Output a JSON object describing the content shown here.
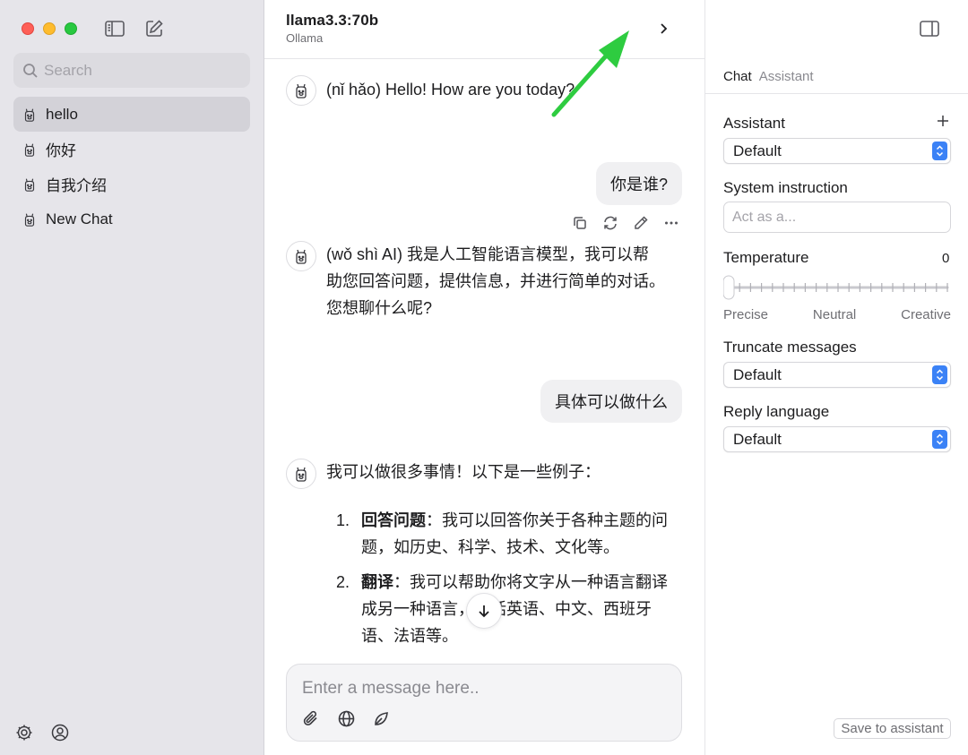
{
  "sidebar": {
    "search_placeholder": "Search",
    "chats": [
      {
        "label": "hello",
        "active": true
      },
      {
        "label": "你好",
        "active": false
      },
      {
        "label": "自我介绍",
        "active": false
      },
      {
        "label": "New Chat",
        "active": false
      }
    ]
  },
  "header": {
    "model_name": "llama3.3:70b",
    "provider": "Ollama"
  },
  "messages": {
    "m1_ai": "(nǐ hǎo) Hello! How are you today?",
    "m2_user": "你是谁?",
    "m3_ai_lines": [
      "(wǒ shì AI) 我是人工智能语言模型，我可以帮",
      "助您回答问题，提供信息，并进行简单的对话。",
      "您想聊什么呢?"
    ],
    "m4_user": "具体可以做什么",
    "m5_ai_intro": "我可以做很多事情！以下是一些例子：",
    "list": [
      {
        "num": "1.",
        "title": "回答问题",
        "lines": [
          "：我可以回答你关于各种主题的问",
          "题，如历史、科学、技术、文化等。"
        ]
      },
      {
        "num": "2.",
        "title": "翻译",
        "lines": [
          "：我可以帮助你将文字从一种语言翻译",
          "成另一种语言，包括英语、中文、西班牙",
          "语、法语等。"
        ]
      }
    ]
  },
  "composer": {
    "placeholder": "Enter a message here.."
  },
  "panel": {
    "tabs": [
      "Chat",
      "Assistant"
    ],
    "assistant_label": "Assistant",
    "assistant_value": "Default",
    "system_label": "System instruction",
    "system_placeholder": "Act as a...",
    "temperature_label": "Temperature",
    "temperature_value": "0",
    "slider_labels": [
      "Precise",
      "Neutral",
      "Creative"
    ],
    "truncate_label": "Truncate messages",
    "truncate_value": "Default",
    "reply_label": "Reply language",
    "reply_value": "Default",
    "save_button": "Save to assistant"
  },
  "colors": {
    "accent_blue": "#3b82f6",
    "annotation_arrow": "#2ecc40"
  }
}
